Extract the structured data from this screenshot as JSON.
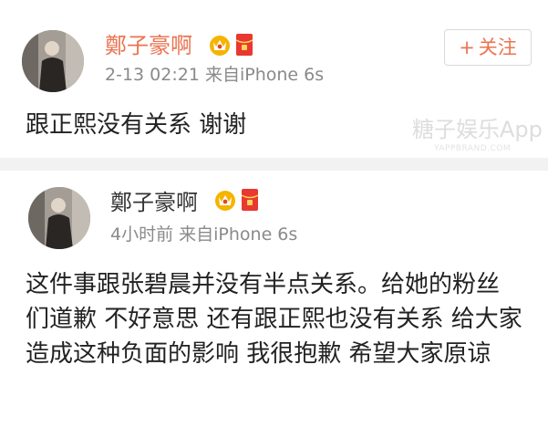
{
  "posts": [
    {
      "author": "鄭子豪啊",
      "meta": "2-13 02:21  来自iPhone 6s",
      "body": "跟正熙没有关系 谢谢",
      "follow_plus": "+",
      "follow_label": "关注",
      "badges": [
        "vip-crown-icon",
        "red-envelope-icon"
      ]
    },
    {
      "author": "鄭子豪啊",
      "meta": "4小时前  来自iPhone 6s",
      "body": "这件事跟张碧晨并没有半点关系。给她的粉丝们道歉 不好意思  还有跟正熙也没有关系  给大家造成这种负面的影响 我很抱歉 希望大家原谅",
      "badges": [
        "vip-crown-icon",
        "red-envelope-icon"
      ]
    }
  ],
  "watermark": {
    "text": "糖子娱乐App",
    "sub": "YAPPBRAND.COM"
  },
  "colors": {
    "accent": "#eb7350",
    "text": "#222222",
    "meta": "#8a8a8a",
    "separator": "#f2f2f2"
  }
}
